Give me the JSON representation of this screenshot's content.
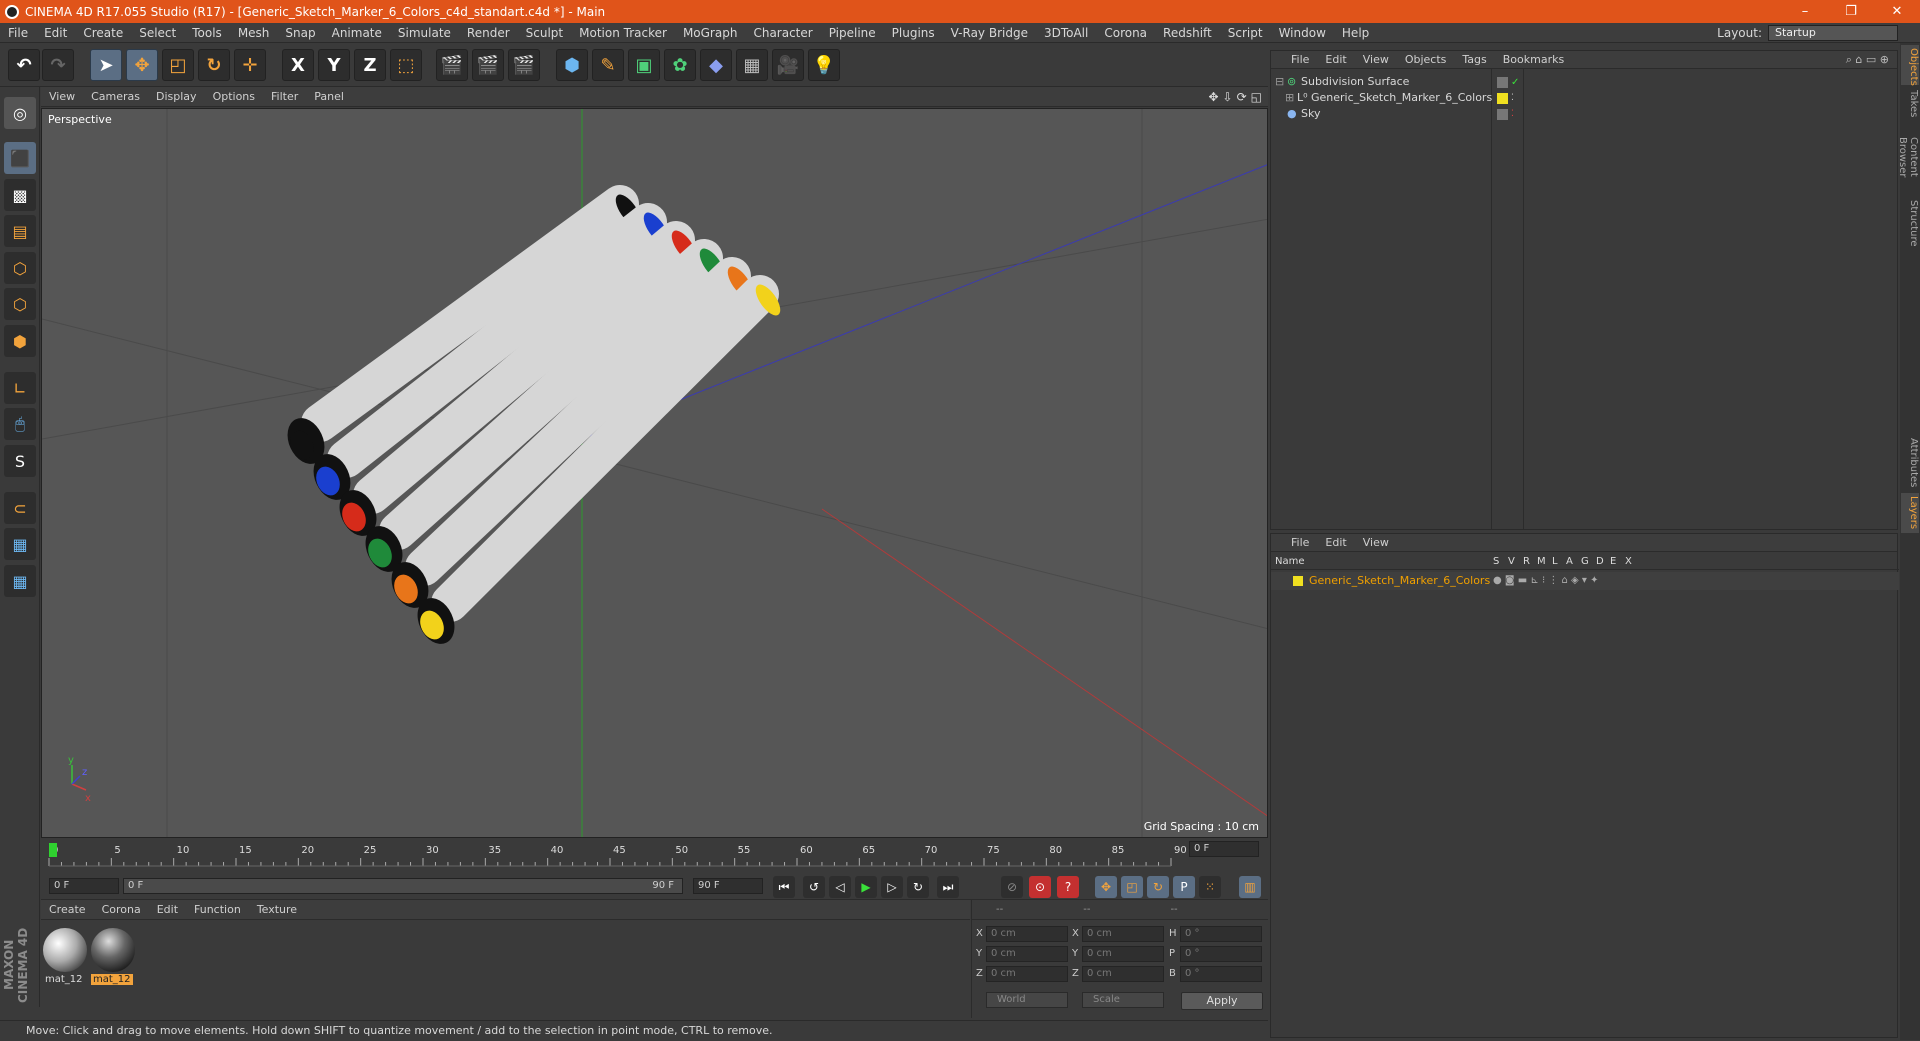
{
  "window": {
    "title": "CINEMA 4D R17.055 Studio (R17) - [Generic_Sketch_Marker_6_Colors_c4d_standart.c4d *] - Main",
    "controls": [
      "–",
      "❐",
      "✕"
    ]
  },
  "menubar": {
    "items": [
      "File",
      "Edit",
      "Create",
      "Select",
      "Tools",
      "Mesh",
      "Snap",
      "Animate",
      "Simulate",
      "Render",
      "Sculpt",
      "Motion Tracker",
      "MoGraph",
      "Character",
      "Pipeline",
      "Plugins",
      "V-Ray Bridge",
      "3DToAll",
      "Corona",
      "Redshift",
      "Script",
      "Window",
      "Help"
    ],
    "layout_label": "Layout:",
    "layout_value": "Startup"
  },
  "toolbar": {
    "axis_x": "X",
    "axis_y": "Y",
    "axis_z": "Z"
  },
  "left_tools": {
    "sculpt_label": "S"
  },
  "viewport": {
    "menu": [
      "View",
      "Cameras",
      "Display",
      "Options",
      "Filter",
      "Panel"
    ],
    "label": "Perspective",
    "grid_spacing": "Grid Spacing : 10 cm",
    "axis_y": "y",
    "axis_x": "x",
    "axis_z": "z",
    "marker_colors": [
      "#111111",
      "#1a3fcf",
      "#d62b1a",
      "#1f8a3a",
      "#e8751a",
      "#f2d21b"
    ]
  },
  "timeline": {
    "ticks": [
      "0",
      "5",
      "10",
      "15",
      "20",
      "25",
      "30",
      "35",
      "40",
      "45",
      "50",
      "55",
      "60",
      "65",
      "70",
      "75",
      "80",
      "85",
      "90"
    ],
    "current_frame": "0 F"
  },
  "anim": {
    "start": "0 F",
    "range_start": "0 F",
    "range_end": "90 F",
    "end": "90 F"
  },
  "material_manager": {
    "menu": [
      "Create",
      "Corona",
      "Edit",
      "Function",
      "Texture"
    ],
    "materials": [
      {
        "name": "mat_12"
      },
      {
        "name": "mat_12"
      }
    ]
  },
  "coords": {
    "header": [
      "--",
      "--",
      "--"
    ],
    "rows": [
      {
        "l1": "X",
        "v1": "0 cm",
        "l2": "X",
        "v2": "0 cm",
        "l3": "H",
        "v3": "0 °"
      },
      {
        "l1": "Y",
        "v1": "0 cm",
        "l2": "Y",
        "v2": "0 cm",
        "l3": "P",
        "v3": "0 °"
      },
      {
        "l1": "Z",
        "v1": "0 cm",
        "l2": "Z",
        "v2": "0 cm",
        "l3": "B",
        "v3": "0 °"
      }
    ],
    "mode1": "World",
    "mode2": "Scale",
    "apply": "Apply"
  },
  "status": "Move: Click and drag to move elements. Hold down SHIFT to quantize movement / add to the selection in point mode, CTRL to remove.",
  "objects": {
    "menu": [
      "File",
      "Edit",
      "View",
      "Objects",
      "Tags",
      "Bookmarks"
    ],
    "items": [
      {
        "name": "Subdivision Surface"
      },
      {
        "name": "Generic_Sketch_Marker_6_Colors"
      },
      {
        "name": "Sky"
      }
    ]
  },
  "layers": {
    "menu": [
      "File",
      "Edit",
      "View"
    ],
    "columns": [
      "Name",
      "S",
      "V",
      "R",
      "M",
      "L",
      "A",
      "G",
      "D",
      "E",
      "X"
    ],
    "rows": [
      {
        "name": "Generic_Sketch_Marker_6_Colors"
      }
    ]
  },
  "right_tabs": [
    "Objects",
    "Takes",
    "Content Browser",
    "Structure",
    "Attributes",
    "Layers"
  ]
}
